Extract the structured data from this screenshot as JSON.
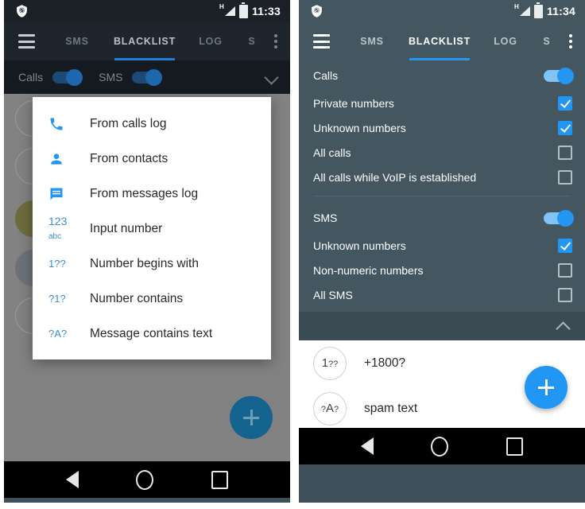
{
  "left_screen": {
    "status_bar": {
      "app_icon": "shield-block-icon",
      "network_type": "H",
      "signal_icon": "signal-bars-icon",
      "battery_icon": "battery-full-icon",
      "time": "11:33"
    },
    "app_bar": {
      "menu_icon": "hamburger-menu-icon",
      "overflow_icon": "kebab-menu-icon",
      "tabs": [
        {
          "label": "SMS",
          "active": false
        },
        {
          "label": "BLACKLIST",
          "active": true
        },
        {
          "label": "LOG",
          "active": false
        },
        {
          "label": "S",
          "active": false
        }
      ]
    },
    "collapsed_filters": {
      "calls_label": "Calls",
      "calls_enabled": true,
      "sms_label": "SMS",
      "sms_enabled": true,
      "expand_icon": "chevron-down-icon"
    },
    "dialog": {
      "items": [
        {
          "icon": "phone-icon",
          "label": "From calls log"
        },
        {
          "icon": "person-icon",
          "label": "From contacts"
        },
        {
          "icon": "message-icon",
          "label": "From messages log"
        },
        {
          "icon": "keyboard-123abc-icon",
          "label": "Input number",
          "glyph_top": "123",
          "glyph_bottom": "abc"
        },
        {
          "icon": "number-begins-icon",
          "label": "Number begins with",
          "glyph": "1??"
        },
        {
          "icon": "number-contains-icon",
          "label": "Number contains",
          "glyph": "?1?"
        },
        {
          "icon": "message-contains-icon",
          "label": "Message contains text",
          "glyph": "?A?"
        }
      ]
    },
    "fab": {
      "icon": "plus-icon",
      "label": "+"
    },
    "nav_bar": {
      "back": "back-triangle-icon",
      "home": "home-circle-icon",
      "recents": "recents-square-icon"
    }
  },
  "right_screen": {
    "status_bar": {
      "app_icon": "shield-block-icon",
      "network_type": "H",
      "signal_icon": "signal-bars-icon",
      "battery_icon": "battery-full-icon",
      "time": "11:34"
    },
    "app_bar": {
      "menu_icon": "hamburger-menu-icon",
      "overflow_icon": "kebab-menu-icon",
      "tabs": [
        {
          "label": "SMS",
          "active": false
        },
        {
          "label": "BLACKLIST",
          "active": true
        },
        {
          "label": "LOG",
          "active": false
        },
        {
          "label": "S",
          "active": false
        }
      ]
    },
    "settings": {
      "calls": {
        "label": "Calls",
        "enabled": true,
        "options": [
          {
            "label": "Private numbers",
            "checked": true
          },
          {
            "label": "Unknown numbers",
            "checked": true
          },
          {
            "label": "All calls",
            "checked": false
          },
          {
            "label": "All calls while VoIP is established",
            "checked": false
          }
        ]
      },
      "sms": {
        "label": "SMS",
        "enabled": true,
        "options": [
          {
            "label": "Unknown numbers",
            "checked": true
          },
          {
            "label": "Non-numeric numbers",
            "checked": false
          },
          {
            "label": "All SMS",
            "checked": false
          }
        ]
      },
      "collapse_icon": "chevron-up-icon"
    },
    "blacklist": {
      "items": [
        {
          "badge": "1??",
          "label": "+1800?"
        },
        {
          "badge": "?A?",
          "label": "spam text"
        }
      ]
    },
    "fab": {
      "icon": "plus-icon",
      "label": "+"
    },
    "nav_bar": {
      "back": "back-triangle-icon",
      "home": "home-circle-icon",
      "recents": "recents-square-icon"
    }
  },
  "colors": {
    "accent": "#2196f3",
    "app_bar_dark": "#1e252c",
    "app_bar_light": "#44565f",
    "dim_overlay": "#828282",
    "nav_bar": "#000000"
  }
}
